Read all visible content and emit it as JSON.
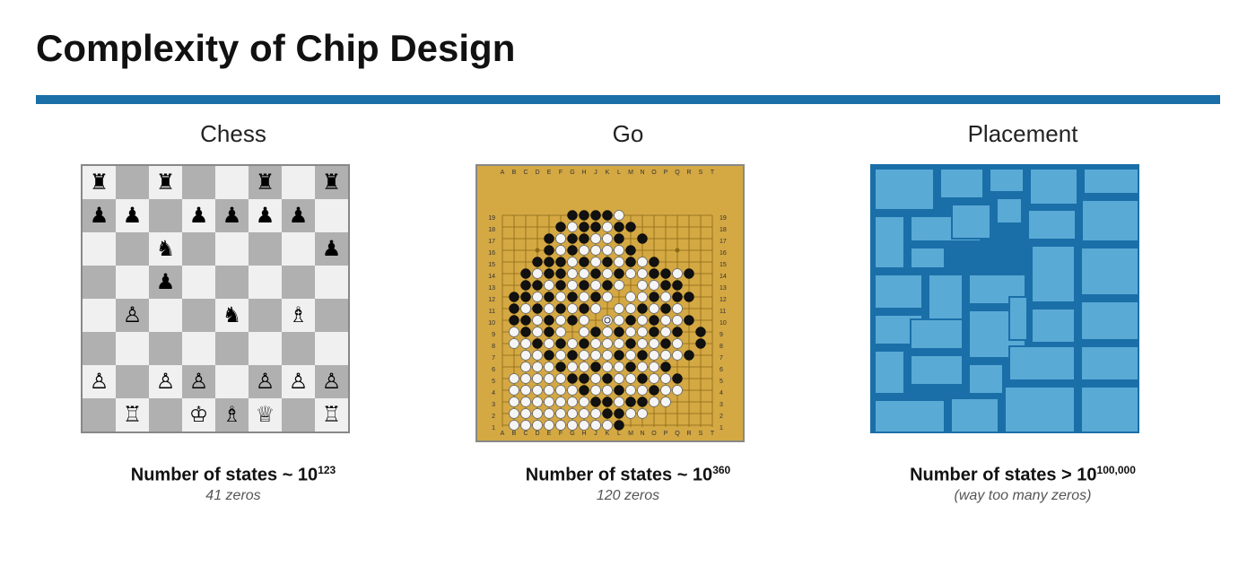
{
  "title": "Complexity of Chip Design",
  "columns": [
    {
      "id": "chess",
      "label": "Chess",
      "stat_text": "Number of states ~ 10",
      "stat_exp": "123",
      "stat_sub": "41 zeros"
    },
    {
      "id": "go",
      "label": "Go",
      "stat_text": "Number of states ~ 10",
      "stat_exp": "360",
      "stat_sub": "120 zeros"
    },
    {
      "id": "placement",
      "label": "Placement",
      "stat_text": "Number of states > 10",
      "stat_exp": "100,000",
      "stat_sub": "(way too many zeros)"
    }
  ],
  "chess_pieces": [
    [
      "♜",
      "",
      "♜",
      "",
      "",
      "♜",
      "",
      "♜"
    ],
    [
      "♟",
      "♟",
      "",
      "♟",
      "♟",
      "♟",
      "♟",
      ""
    ],
    [
      "",
      "",
      "♞",
      "",
      "",
      "",
      "",
      "♟"
    ],
    [
      "",
      "",
      "♟",
      "",
      "",
      "",
      "",
      ""
    ],
    [
      "",
      "♙",
      "",
      "",
      "♞",
      "",
      "♗",
      ""
    ],
    [
      "",
      "",
      "",
      "",
      "",
      "",
      "",
      ""
    ],
    [
      "♙",
      "",
      "♙",
      "♙",
      "",
      "♙",
      "♙",
      "♙"
    ],
    [
      "",
      "♖",
      "",
      "♔",
      "♗",
      "♕",
      "",
      "♖"
    ]
  ],
  "go_col_labels": [
    "A",
    "B",
    "C",
    "D",
    "E",
    "F",
    "G",
    "H",
    "J",
    "K",
    "L",
    "M",
    "N",
    "O",
    "P",
    "Q",
    "R",
    "S",
    "T"
  ],
  "accent_color": "#1a6fa8"
}
